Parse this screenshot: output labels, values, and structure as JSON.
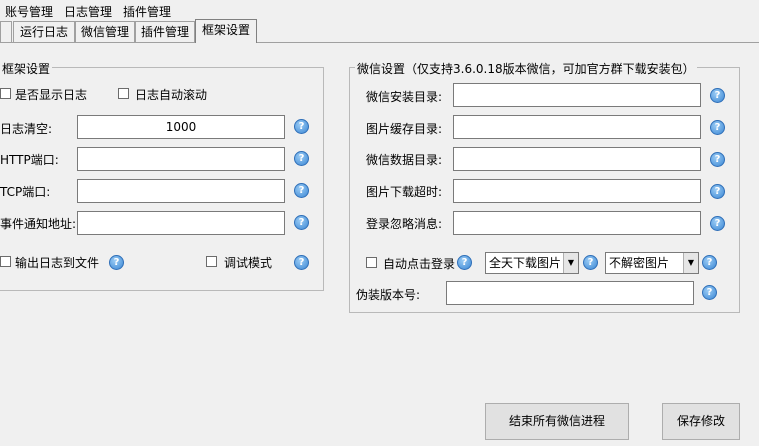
{
  "menu": {
    "account": "账号管理",
    "log": "日志管理",
    "plugin": "插件管理"
  },
  "tabs": [
    "运行日志",
    "微信管理",
    "插件管理",
    "框架设置"
  ],
  "framework": {
    "title": "框架设置",
    "show_log": "是否显示日志",
    "auto_scroll": "日志自动滚动",
    "log_clear_label": "日志清空:",
    "log_clear_value": "1000",
    "http_port_label": "HTTP端口:",
    "tcp_port_label": "TCP端口:",
    "event_url_label": "事件通知地址:",
    "log_to_file": "输出日志到文件",
    "debug_mode": "调试模式"
  },
  "wechat": {
    "title": "微信设置（仅支持3.6.0.18版本微信，可加官方群下载安装包）",
    "install_dir": "微信安装目录:",
    "image_cache_dir": "图片缓存目录:",
    "data_dir": "微信数据目录:",
    "image_timeout": "图片下载超时:",
    "ignore_msg": "登录忽略消息:",
    "auto_login": "自动点击登录",
    "download_option": "全天下载图片",
    "decrypt_option": "不解密图片",
    "fake_version_label": "伪装版本号:"
  },
  "buttons": {
    "kill_all": "结束所有微信进程",
    "save": "保存修改"
  },
  "icons": {
    "help": "?"
  }
}
